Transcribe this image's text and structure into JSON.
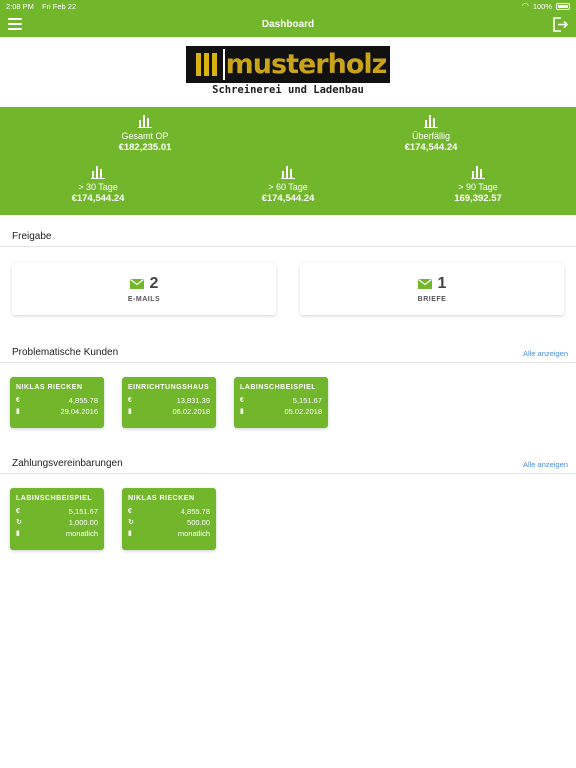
{
  "status": {
    "time": "2:08 PM",
    "date": "Fri Feb 22",
    "battery": "100%"
  },
  "nav": {
    "title": "Dashboard"
  },
  "logo": {
    "word": "musterholz",
    "subtitle": "Schreinerei und Ladenbau"
  },
  "stats": [
    {
      "label": "Gesamt OP",
      "value": "€182,235.01"
    },
    {
      "label": "Überfällig",
      "value": "€174,544.24"
    },
    {
      "label": "> 30 Tage",
      "value": "€174,544.24"
    },
    {
      "label": "> 60 Tage",
      "value": "€174,544.24"
    },
    {
      "label": "> 90 Tage",
      "value": "169,392.57"
    }
  ],
  "freigabe": {
    "title": "Freigabe",
    "cards": [
      {
        "count": "2",
        "label": "E-MAILS"
      },
      {
        "count": "1",
        "label": "BRIEFE"
      }
    ]
  },
  "problem": {
    "title": "Problematische Kunden",
    "link": "Alle anzeigen",
    "cards": [
      {
        "name": "NIKLAS RIECKEN",
        "amount": "4,855.78",
        "date": "29.04.2016"
      },
      {
        "name": "EINRICHTUNGSHAUS RO",
        "amount": "13,831.39",
        "date": "06.02.2018"
      },
      {
        "name": "LABINSCHBEISPIEL",
        "amount": "5,151.67",
        "date": "05.02.2018"
      }
    ]
  },
  "zahlung": {
    "title": "Zahlungsvereinbarungen",
    "link": "Alle anzeigen",
    "cards": [
      {
        "name": "LABINSCHBEISPIEL",
        "amount": "5,151.67",
        "rate": "1,000.00",
        "interval": "monatlich"
      },
      {
        "name": "NIKLAS RIECKEN",
        "amount": "4,855.78",
        "rate": "500.00",
        "interval": "monatlich"
      }
    ]
  },
  "icons": {
    "currency": "€",
    "document": "▮",
    "repeat": "↻",
    "calendar": "▮"
  },
  "colors": {
    "accent": "#72b62c",
    "link": "#4a8fe2"
  }
}
